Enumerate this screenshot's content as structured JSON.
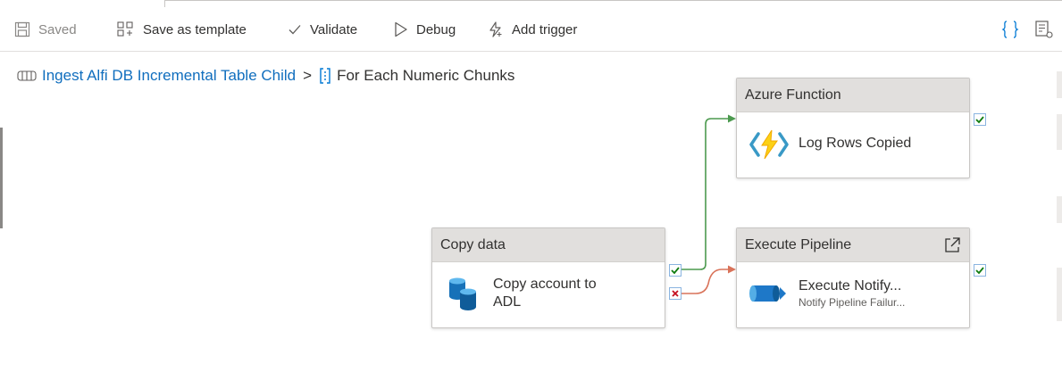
{
  "toolbar": {
    "saved": "Saved",
    "save_template": "Save as template",
    "validate": "Validate",
    "debug": "Debug",
    "add_trigger": "Add trigger"
  },
  "breadcrumb": {
    "pipeline": "Ingest Alfi DB Incremental Table Child",
    "separator": ">",
    "current": "For Each Numeric Chunks"
  },
  "nodes": {
    "azure_function": {
      "type": "Azure Function",
      "name": "Log Rows Copied"
    },
    "copy_data": {
      "type": "Copy data",
      "name_line1": "Copy account to",
      "name_line2": "ADL"
    },
    "execute_pipeline": {
      "type": "Execute Pipeline",
      "name": "Execute Notify...",
      "description": "Notify Pipeline Failur..."
    }
  },
  "colors": {
    "success_edge": "#4c9a4f",
    "failure_edge": "#d9735a",
    "link": "#106ebe"
  }
}
